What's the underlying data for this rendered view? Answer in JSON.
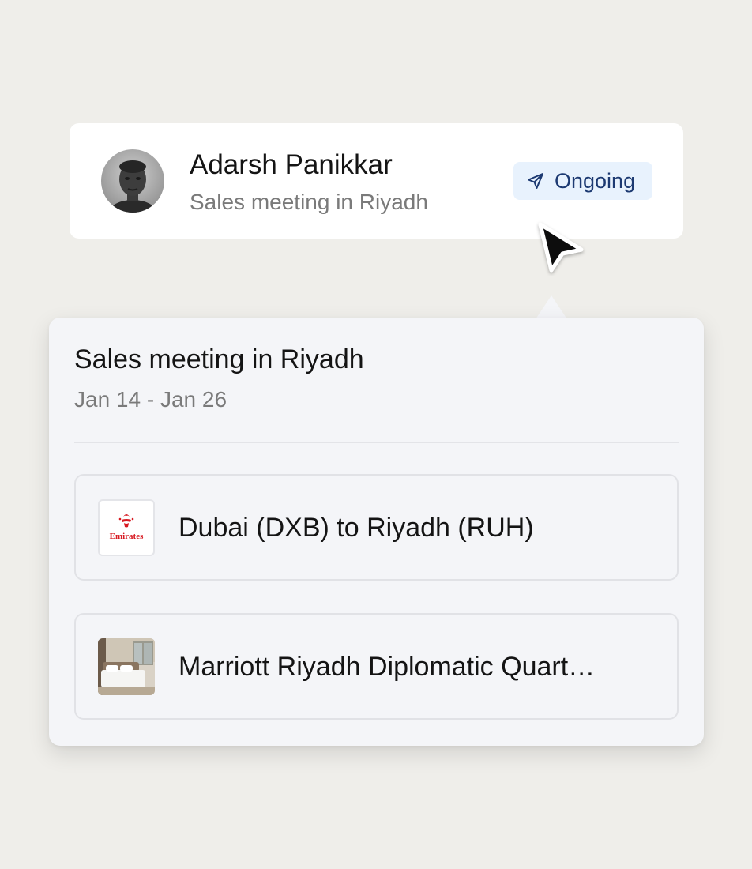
{
  "trip_card": {
    "traveler_name": "Adarsh Panikkar",
    "trip_name": "Sales meeting in Riyadh",
    "status": {
      "label": "Ongoing",
      "icon": "send-icon",
      "color": "#1d3a72",
      "background": "#e8f2fd"
    },
    "avatar_icon": "avatar-photo"
  },
  "popover": {
    "title": "Sales meeting in Riyadh",
    "dates": "Jan 14 - Jan 26",
    "bookings": [
      {
        "type": "flight",
        "label": "Dubai (DXB) to Riyadh (RUH)",
        "logo_text": "Emirates",
        "logo_color": "#d71921"
      },
      {
        "type": "hotel",
        "label": "Marriott Riyadh Diplomatic Quart…",
        "icon": "hotel-photo"
      }
    ]
  },
  "colors": {
    "page_background": "#efeeea",
    "card_background": "#ffffff",
    "popover_background": "#f4f5f8",
    "muted_text": "#7a7a7a"
  }
}
